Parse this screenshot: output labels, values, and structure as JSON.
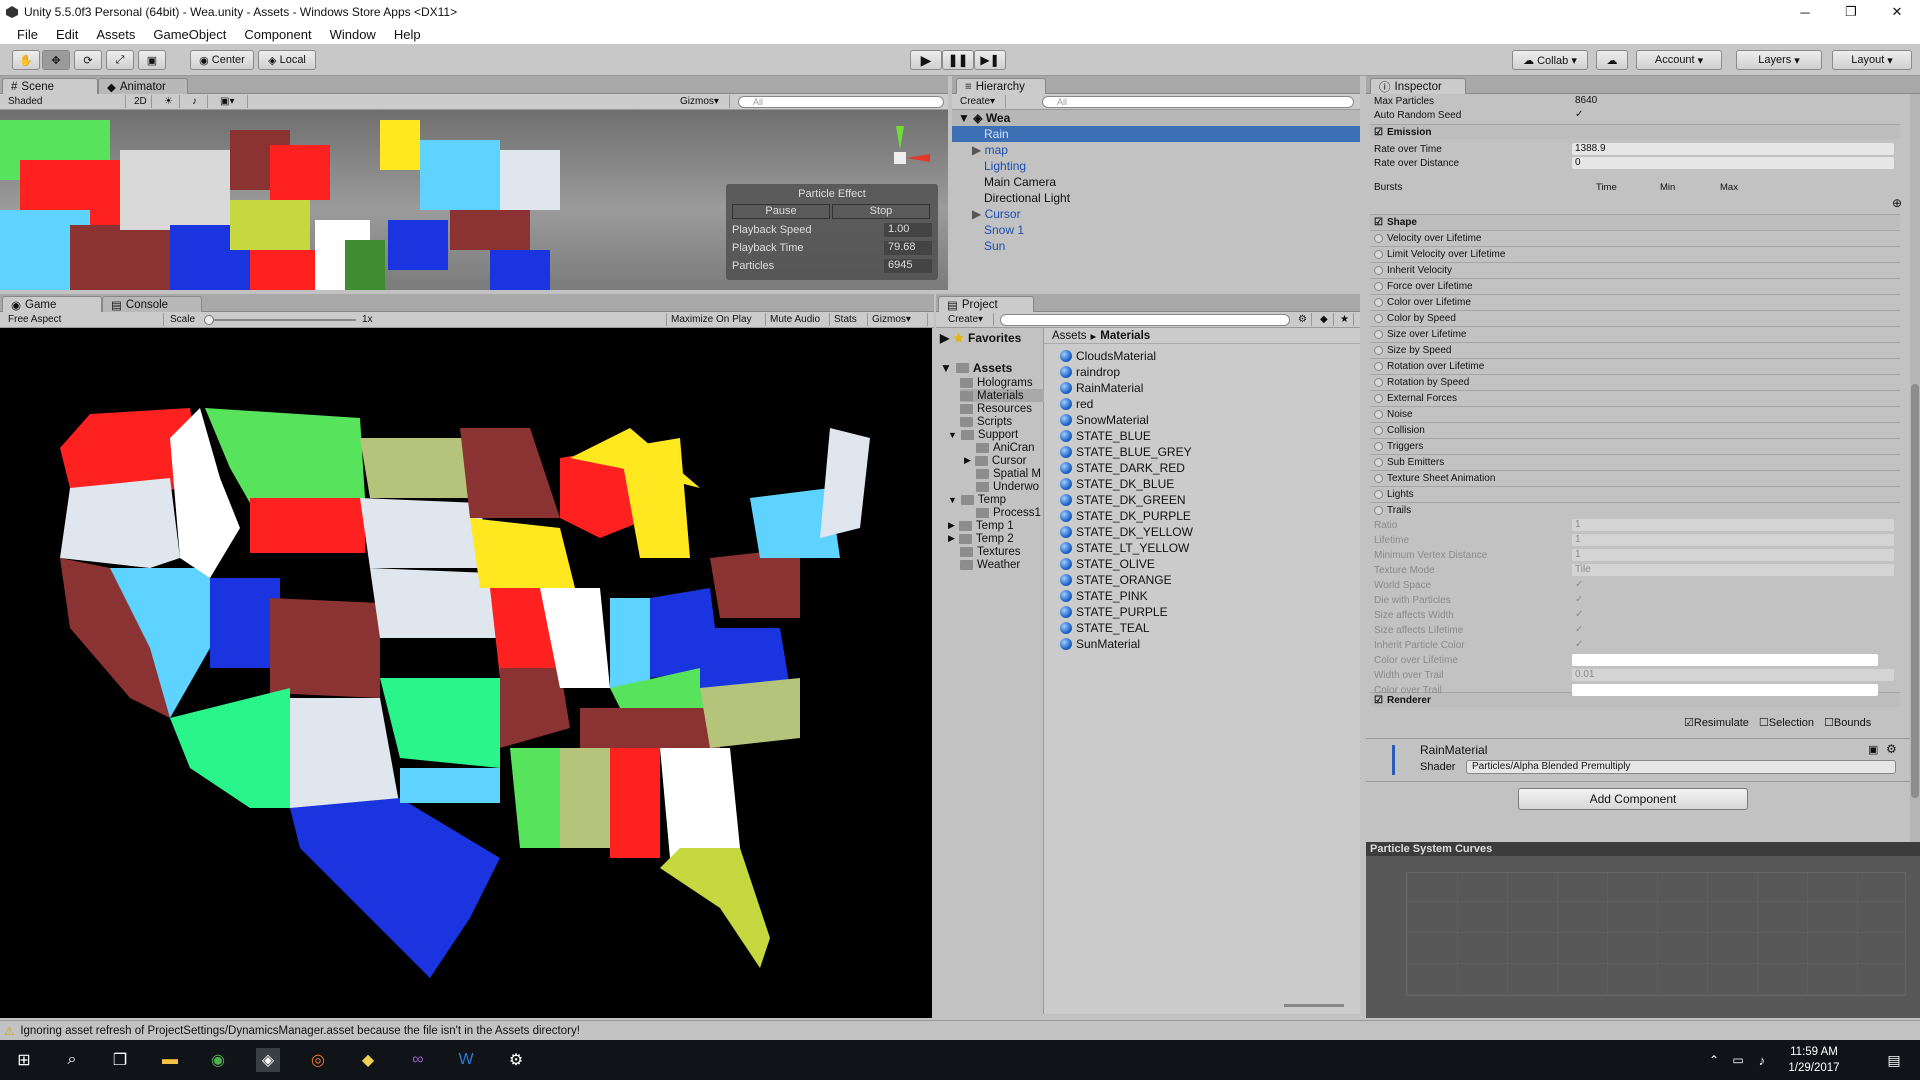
{
  "window": {
    "title": "Unity 5.5.0f3 Personal (64bit) - Wea.unity - Assets - Windows Store Apps <DX11>",
    "minimize": "─",
    "maximize": "❐",
    "close": "✕"
  },
  "menu": [
    "File",
    "Edit",
    "Assets",
    "GameObject",
    "Component",
    "Window",
    "Help"
  ],
  "toolbar": {
    "center": "Center",
    "local": "Local",
    "collab": "Collab ▾",
    "account": "Account",
    "layers": "Layers",
    "layout": "Layout"
  },
  "scene": {
    "tabs": [
      "Scene",
      "Animator"
    ],
    "shading": "Shaded",
    "mode2d": "2D",
    "gizmos": "Gizmos",
    "search_placeholder": "All",
    "particle_effect": {
      "title": "Particle Effect",
      "pause": "Pause",
      "stop": "Stop",
      "rows": [
        {
          "label": "Playback Speed",
          "value": "1.00"
        },
        {
          "label": "Playback Time",
          "value": "79.68"
        },
        {
          "label": "Particles",
          "value": "6945"
        }
      ]
    }
  },
  "game": {
    "tabs": [
      "Game",
      "Console"
    ],
    "aspect": "Free Aspect",
    "scale_label": "Scale",
    "scale_value": "1x",
    "buttons": [
      "Maximize On Play",
      "Mute Audio",
      "Stats",
      "Gizmos"
    ]
  },
  "hierarchy": {
    "tab": "Hierarchy",
    "create": "Create",
    "search_placeholder": "All",
    "scene": "Wea",
    "items": [
      "Rain",
      "map",
      "Lighting",
      "Main Camera",
      "Directional Light",
      "Cursor",
      "Snow 1",
      "Sun"
    ]
  },
  "project": {
    "tab": "Project",
    "create": "Create",
    "favorites": "Favorites",
    "assets": "Assets",
    "tree": [
      "Holograms",
      "Materials",
      "Resources",
      "Scripts",
      "Support",
      "AniCran",
      "Cursor",
      "Spatial M",
      "Underwo",
      "Temp",
      "Process1",
      "Temp 1",
      "Temp 2",
      "Textures",
      "Weather"
    ],
    "breadcrumb": [
      "Assets",
      "Materials"
    ],
    "files": [
      "CloudsMaterial",
      "raindrop",
      "RainMaterial",
      "red",
      "SnowMaterial",
      "STATE_BLUE",
      "STATE_BLUE_GREY",
      "STATE_DARK_RED",
      "STATE_DK_BLUE",
      "STATE_DK_GREEN",
      "STATE_DK_PURPLE",
      "STATE_DK_YELLOW",
      "STATE_LT_YELLOW",
      "STATE_OLIVE",
      "STATE_ORANGE",
      "STATE_PINK",
      "STATE_PURPLE",
      "STATE_TEAL",
      "SunMaterial"
    ]
  },
  "inspector": {
    "tab": "Inspector",
    "top_props": [
      {
        "label": "Max Particles",
        "value": "8640"
      },
      {
        "label": "Auto Random Seed",
        "value": "✓"
      }
    ],
    "emission": "Emission",
    "emission_props": [
      {
        "label": "Rate over Time",
        "value": "1388.9"
      },
      {
        "label": "Rate over Distance",
        "value": "0"
      }
    ],
    "bursts": "Bursts",
    "bursts_cols": [
      "Time",
      "Min",
      "Max"
    ],
    "modules": [
      "Shape",
      "Velocity over Lifetime",
      "Limit Velocity over Lifetime",
      "Inherit Velocity",
      "Force over Lifetime",
      "Color over Lifetime",
      "Color by Speed",
      "Size over Lifetime",
      "Size by Speed",
      "Rotation over Lifetime",
      "Rotation by Speed",
      "External Forces",
      "Noise",
      "Collision",
      "Triggers",
      "Sub Emitters",
      "Texture Sheet Animation",
      "Lights",
      "Trails"
    ],
    "trail_props": [
      {
        "label": "Ratio",
        "value": "1"
      },
      {
        "label": "Lifetime",
        "value": "1"
      },
      {
        "label": "Minimum Vertex Distance",
        "value": "1"
      },
      {
        "label": "Texture Mode",
        "value": "Tile"
      },
      {
        "label": "World Space",
        "value": "✓"
      },
      {
        "label": "Die with Particles",
        "value": "✓"
      },
      {
        "label": "Size affects Width",
        "value": "✓"
      },
      {
        "label": "Size affects Lifetime",
        "value": "✓"
      },
      {
        "label": "Inherit Particle Color",
        "value": "✓"
      },
      {
        "label": "Color over Lifetime",
        "value": ""
      },
      {
        "label": "Width over Trail",
        "value": "0.01"
      },
      {
        "label": "Color over Trail",
        "value": ""
      }
    ],
    "renderer": "Renderer",
    "toggles": [
      "Resimulate",
      "Selection",
      "Bounds"
    ],
    "material": "RainMaterial",
    "shader_label": "Shader",
    "shader": "Particles/Alpha Blended Premultiply",
    "add_component": "Add Component",
    "curves_title": "Particle System Curves"
  },
  "status": "Ignoring asset refresh of ProjectSettings/DynamicsManager.asset because the file isn't in the Assets directory!",
  "clock": {
    "time": "11:59 AM",
    "date": "1/29/2017"
  },
  "colors": {
    "selection": "#3d6fb5",
    "game_bg": "#000000",
    "link_blue": "#1b4fb0"
  }
}
